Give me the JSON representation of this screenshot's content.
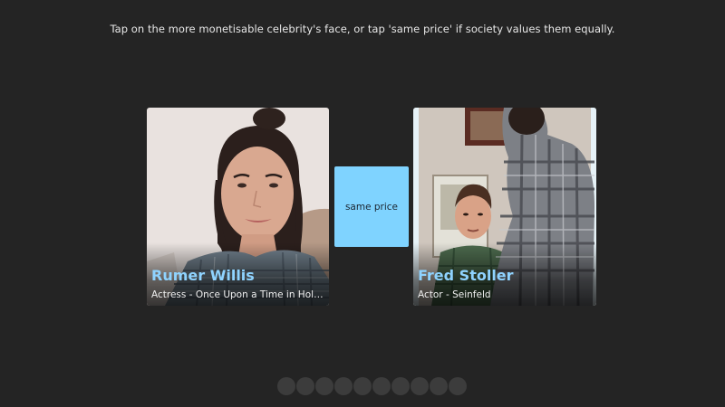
{
  "instruction": "Tap on the more monetisable celebrity's face, or tap 'same price' if society values them equally.",
  "left_card": {
    "name": "Rumer Willis",
    "description": "Actress - Once Upon a Time in Hollywo…"
  },
  "right_card": {
    "name": "Fred Stoller",
    "description": "Actor - Seinfeld"
  },
  "same_price_label": "same price",
  "progress": {
    "total": 10,
    "completed": 0
  },
  "colors": {
    "background": "#242424",
    "accent": "#7fd3ff",
    "name_text": "#8fd3ff",
    "dot": "#3c3c3c"
  }
}
